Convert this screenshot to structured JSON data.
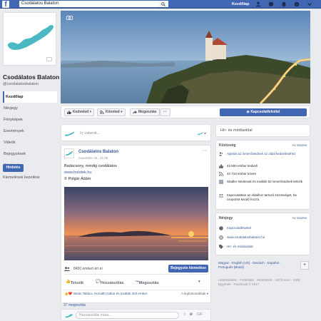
{
  "topbar": {
    "search_value": "Csodálatos Balaton",
    "home_label": "Kezdőlap",
    "logo_letter": "f"
  },
  "left": {
    "page_name": "Csodálatos Balaton",
    "handle": "@csodalatosbalaton",
    "nav": [
      "Kezdőlap",
      "Névjegy",
      "Fényképek",
      "Események",
      "Videók",
      "Bejegyzések",
      "Közösség"
    ],
    "promote_label": "Hirdetés",
    "manage_promotions": "Kiemelések kezelése"
  },
  "actions": {
    "like": "Kedveled",
    "follow": "Követed",
    "share": "Megosztás",
    "more": "···",
    "send_message": "Kapcsolatfelvétel"
  },
  "composer": {
    "placeholder": "Írj valamit..."
  },
  "post": {
    "author": "Csodálatos Balaton",
    "time": "november 26., 21:09 · ",
    "text1": "Badacsony, mindig csodálatos",
    "link": "www.holotek.hu",
    "credit": "© Polgár Ádám",
    "reach": "8450 embert ért el",
    "boost": "Bejegyzés kiemelése",
    "like": "Tetszik",
    "comment": "Hozzászólás",
    "share": "Megosztás",
    "likes_text": "István Takács, Horváth Gábor és további 403 ember",
    "sort": "A legfontosabbak ▾",
    "shares": "37 megosztás",
    "comment_placeholder": "Hozzászólás írása..."
  },
  "right": {
    "news_title": "Hír- és médiaoldal",
    "community_title": "Közösség",
    "community_all": "Az összes",
    "community_rows": [
      "Ajánlás az ismerőseidnek az oldal kedveléséhez",
      "43 500 ember kedveli",
      "42 710 ember követi",
      "Stadler Istvánnak és további 52 ismerősödnek tetszik",
      "Kapcsolatban az oldalhoz tartozó közösséget, ha csoportot kezdő hozzá."
    ],
    "about_title": "Névjegy",
    "about_all": "Az összes",
    "about_rows": [
      "Kapcsolatfelvétel",
      "www.csodalatosbalaton.hu",
      "Hír- és médiaoldal"
    ],
    "languages": "Magyar · English (US) · Deutsch · Español · Português (Brasil)",
    "footer": "Adatvédelem · Feltételek · Hirdetések · AdChoices · Sütik · Egyebek · Facebook © 2017"
  },
  "colors": {
    "brand": "#4267b2",
    "link": "#365899",
    "background": "#e9ebee"
  }
}
